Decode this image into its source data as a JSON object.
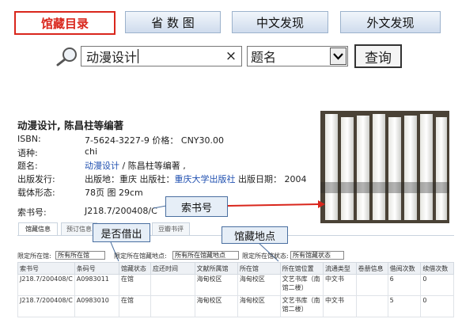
{
  "top_tabs": [
    {
      "label": "馆藏目录",
      "active": true
    },
    {
      "label": "省 数 图",
      "active": false
    },
    {
      "label": "中文发现",
      "active": false
    },
    {
      "label": "外文发现",
      "active": false
    }
  ],
  "search": {
    "query": "动漫设计",
    "clear_symbol": "×",
    "field": "题名",
    "button": "查询"
  },
  "record": {
    "title": "动漫设计, 陈昌柱等编著",
    "rows": [
      {
        "label": "ISBN:",
        "value": "7-5624-3227-9 价格： CNY30.00"
      },
      {
        "label": "语种:",
        "value": "chi"
      },
      {
        "label": "题名:",
        "value_link": "动漫设计",
        "value_rest": " / 陈昌柱等编著 ,"
      },
      {
        "label": "出版发行:",
        "value_pre": "出版地：重庆 出版社：",
        "value_link": "重庆大学出版社",
        "value_post": " 出版日期： 2004"
      },
      {
        "label": "载体形态:",
        "value": "78页 图 29cm"
      },
      {
        "label": "索书号:",
        "value": "J218.7/200408/C"
      }
    ]
  },
  "callouts": {
    "call_number": "索书号",
    "borrowed": "是否借出",
    "location": "馆藏地点"
  },
  "bottom_tabs": [
    "馆藏信息",
    "预订信息",
    "",
    "",
    "豆瓣书评"
  ],
  "filters": {
    "library_label": "限定所在馆:",
    "library_value": "所有所在馆",
    "location_label": "限定所在馆藏地点:",
    "location_value": "所有所在馆藏地点",
    "building_label": "限定所在馆:",
    "status_label": "状态:",
    "status_value": "所有馆藏状态"
  },
  "table": {
    "headers": [
      "索书号",
      "条码号",
      "馆藏状态",
      "应还时间",
      "文献所属馆",
      "所在馆",
      "所在馆位置",
      "流通类型",
      "卷册信息",
      "借阅次数",
      "续借次数"
    ],
    "rows": [
      [
        "J218.7/200408/C",
        "A0983011",
        "在馆",
        "",
        "海甸校区",
        "海甸校区",
        "文艺书库（南馆二楼）",
        "中文书",
        "",
        "6",
        "0"
      ],
      [
        "J218.7/200408/C",
        "A0983010",
        "在馆",
        "",
        "海甸校区",
        "海甸校区",
        "文艺书库（南馆二楼）",
        "中文书",
        "",
        "5",
        "0"
      ]
    ]
  },
  "colors": {
    "accent_red": "#d9261c",
    "link_blue": "#2050b0",
    "callout_border": "#4a6fa0"
  }
}
